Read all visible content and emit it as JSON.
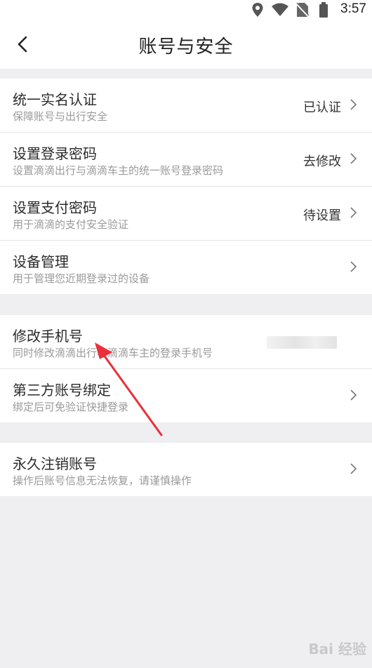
{
  "status_bar": {
    "time": "3:57"
  },
  "header": {
    "title": "账号与安全"
  },
  "groups": [
    {
      "items": [
        {
          "title": "统一实名认证",
          "subtitle": "保障账号与出行安全",
          "status": "已认证"
        },
        {
          "title": "设置登录密码",
          "subtitle": "设置滴滴出行与滴滴车主的统一账号登录密码",
          "status": "去修改"
        },
        {
          "title": "设置支付密码",
          "subtitle": "用于滴滴的支付安全验证",
          "status": "待设置"
        },
        {
          "title": "设备管理",
          "subtitle": "用于管理您近期登录过的设备",
          "status": ""
        }
      ]
    },
    {
      "items": [
        {
          "title": "修改手机号",
          "subtitle": "同时修改滴滴出行与滴滴车主的登录手机号",
          "status": ""
        },
        {
          "title": "第三方账号绑定",
          "subtitle": "绑定后可免验证快捷登录",
          "status": ""
        }
      ]
    },
    {
      "items": [
        {
          "title": "永久注销账号",
          "subtitle": "操作后账号信息无法恢复，请谨慎操作",
          "status": ""
        }
      ]
    }
  ],
  "annotation": {
    "arrow_color": "#e8313a"
  },
  "watermark": "Bai 经验"
}
